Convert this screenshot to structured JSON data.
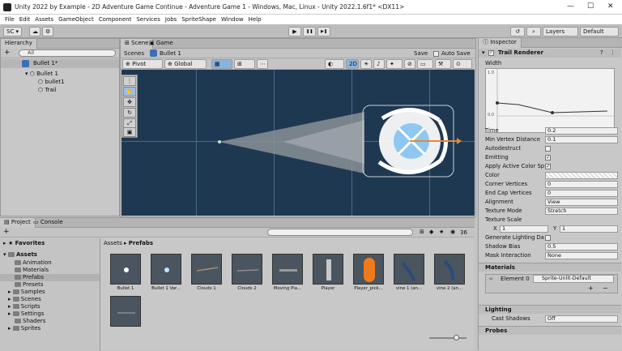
{
  "titlebar": {
    "title": "Unity 2022 by Example - 2D Adventure Game Continue - Adventure Game 1 - Windows, Mac, Linux - Unity 2022.1.6f1* <DX11>",
    "minimize": "—",
    "maximize": "☐",
    "close": "✕"
  },
  "menu": [
    "File",
    "Edit",
    "Assets",
    "GameObject",
    "Component",
    "Services",
    "Jobs",
    "SpriteShape",
    "Window",
    "Help"
  ],
  "toolbar": {
    "account": "SC ▾",
    "play": "▶",
    "pause": "❚❚",
    "step": "▶❚",
    "layers": "Layers",
    "layout": "Default"
  },
  "hierarchy": {
    "tab": "Hierarchy",
    "add": "+",
    "search": "All",
    "prefab": "Bullet 1*",
    "root": "Bullet 1",
    "children": [
      "bullet1",
      "Trail"
    ]
  },
  "scene": {
    "tab_scene": "Scene",
    "tab_game": "Game",
    "breadcrumb_root": "Scenes",
    "breadcrumb_item": "Bullet 1",
    "save": "Save",
    "auto_save": "Auto Save",
    "pivot": "Pivot",
    "global": "Global"
  },
  "inspector": {
    "tab": "Inspector",
    "component": "Trail Renderer",
    "width_label": "Width",
    "curve_top": "1.0",
    "curve_bottom": "0.0",
    "props": [
      {
        "label": "Time",
        "value": "0.2"
      },
      {
        "label": "Min Vertex Distance",
        "value": "0.1"
      },
      {
        "label": "Autodestruct",
        "check": ""
      },
      {
        "label": "Emitting",
        "check": "✓"
      },
      {
        "label": "Apply Active Color Sp",
        "check": "✓"
      },
      {
        "label": "Color",
        "value": ""
      },
      {
        "label": "Corner Vertices",
        "value": "0"
      },
      {
        "label": "End Cap Vertices",
        "value": "0"
      },
      {
        "label": "Alignment",
        "value": "View"
      },
      {
        "label": "Texture Mode",
        "value": "Stretch"
      },
      {
        "label": "Texture Scale",
        "value": ""
      }
    ],
    "texture_scale": {
      "x_label": "X",
      "x": "1",
      "y_label": "Y",
      "y": "1"
    },
    "props2": [
      {
        "label": "Generate Lighting Da",
        "check": ""
      },
      {
        "label": "Shadow Bias",
        "value": "0.5"
      },
      {
        "label": "Mask Interaction",
        "value": "None"
      }
    ],
    "materials": "Materials",
    "element": "Element 0",
    "element_value": "Sprite-Unlit-Default",
    "plus": "+",
    "minus": "−",
    "lighting": "Lighting",
    "cast_shadows": "Cast Shadows",
    "cast_value": "Off",
    "probes": "Probes"
  },
  "project": {
    "tab_project": "Project",
    "tab_console": "Console",
    "count": "36",
    "favorites": "Favorites",
    "breadcrumb_root": "Assets",
    "breadcrumb_item": "Prefabs",
    "tree": [
      "Assets",
      "Animation",
      "Materials",
      "Prefabs",
      "Presets",
      "Samples",
      "Scenes",
      "Scripts",
      "Settings",
      "Shaders",
      "Sprites"
    ],
    "assets": [
      "Bullet 1",
      "Bullet 1 Var...",
      "Clouds 1",
      "Clouds 2",
      "Moving Pla...",
      "Player",
      "Player_pick...",
      "vine 1 (an...",
      "vine 2 (an...",
      ""
    ]
  },
  "colors": {
    "scene_bg": "#1f3852",
    "accent": "#3d6fb6"
  }
}
